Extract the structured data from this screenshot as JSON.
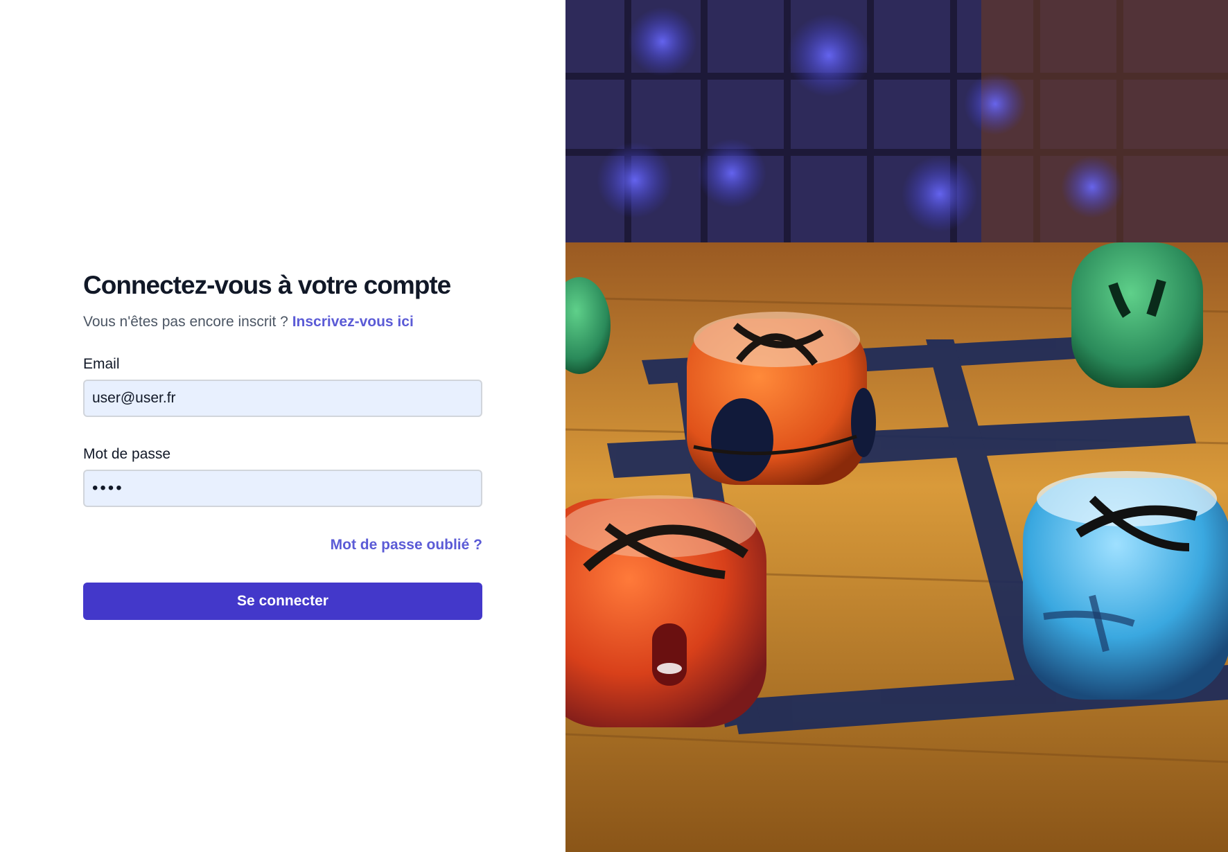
{
  "login": {
    "title": "Connectez-vous à votre compte",
    "subtitle_text": "Vous n'êtes pas encore inscrit ?",
    "signup_link": "Inscrivez-vous ici",
    "email_label": "Email",
    "email_value": "user@user.fr",
    "password_label": "Mot de passe",
    "password_value": "test",
    "forgot_link": "Mot de passe oublié ?",
    "submit_label": "Se connecter"
  },
  "hero": {
    "image_subject": "tic-tac-toe dice on a wooden board",
    "colors": {
      "accent": "#4338ca",
      "link": "#5b5bd6",
      "input_bg": "#e8f0fe"
    }
  }
}
